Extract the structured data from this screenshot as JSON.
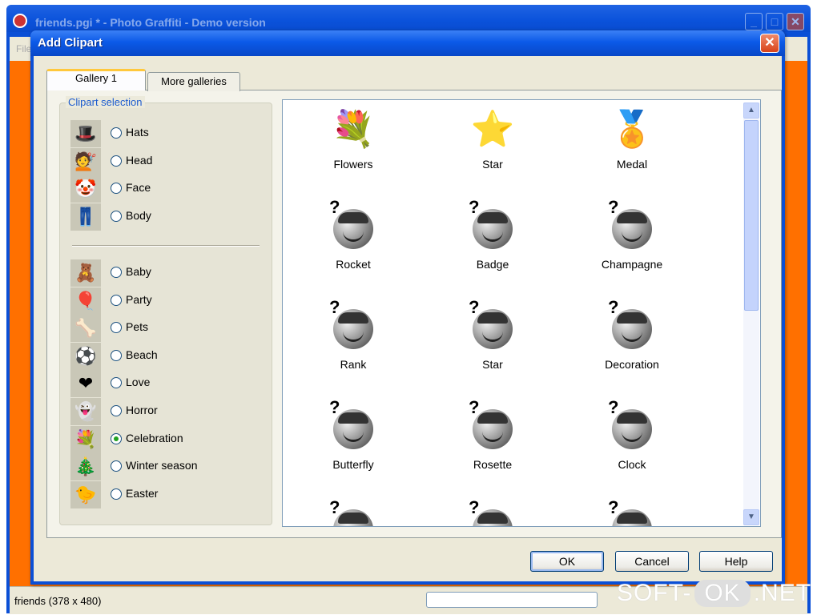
{
  "background_window": {
    "title": "friends.pgi * - Photo Graffiti - Demo version",
    "menu_first": "File",
    "status_text": "friends (378 x 480)",
    "controls": {
      "minimize": "_",
      "maximize": "□",
      "close": "✕"
    }
  },
  "watermark": {
    "prefix": "SOFT-",
    "ok": "OK",
    "suffix": ".NET"
  },
  "dialog": {
    "title": "Add Clipart",
    "close_glyph": "✕",
    "tabs": [
      {
        "label": "Gallery 1",
        "active": true
      },
      {
        "label": "More galleries",
        "active": false
      }
    ],
    "group_label": "Clipart selection",
    "categories_top": [
      {
        "label": "Hats",
        "icon": "hat-icon",
        "glyph": "🎩",
        "checked": false
      },
      {
        "label": "Head",
        "icon": "hair-icon",
        "glyph": "💇",
        "checked": false
      },
      {
        "label": "Face",
        "icon": "clown-nose-icon",
        "glyph": "🤡",
        "checked": false
      },
      {
        "label": "Body",
        "icon": "jeans-icon",
        "glyph": "👖",
        "checked": false
      }
    ],
    "categories_bottom": [
      {
        "label": "Baby",
        "icon": "teddy-bear-icon",
        "glyph": "🧸",
        "checked": false
      },
      {
        "label": "Party",
        "icon": "balloon-icon",
        "glyph": "🎈",
        "checked": false
      },
      {
        "label": "Pets",
        "icon": "bone-icon",
        "glyph": "🦴",
        "checked": false
      },
      {
        "label": "Beach",
        "icon": "beach-ball-icon",
        "glyph": "⚽",
        "checked": false
      },
      {
        "label": "Love",
        "icon": "heart-icon",
        "glyph": "❤",
        "checked": false
      },
      {
        "label": "Horror",
        "icon": "ghost-icon",
        "glyph": "👻",
        "checked": false
      },
      {
        "label": "Celebration",
        "icon": "bouquet-icon",
        "glyph": "💐",
        "checked": true
      },
      {
        "label": "Winter season",
        "icon": "christmas-tree-icon",
        "glyph": "🎄",
        "checked": false
      },
      {
        "label": "Easter",
        "icon": "chick-icon",
        "glyph": "🐤",
        "checked": false
      }
    ],
    "cliparts": [
      {
        "name": "Flowers",
        "art": "flowers-icon",
        "glyph": "💐",
        "placeholder": false
      },
      {
        "name": "Star",
        "art": "star-icon",
        "glyph": "⭐",
        "placeholder": false
      },
      {
        "name": "Medal",
        "art": "medal-icon",
        "glyph": "🏅",
        "placeholder": false
      },
      {
        "name": "Rocket",
        "art": "unknown-clipart-icon",
        "placeholder": true
      },
      {
        "name": "Badge",
        "art": "unknown-clipart-icon",
        "placeholder": true
      },
      {
        "name": "Champagne",
        "art": "unknown-clipart-icon",
        "placeholder": true
      },
      {
        "name": "Rank",
        "art": "unknown-clipart-icon",
        "placeholder": true
      },
      {
        "name": "Star",
        "art": "unknown-clipart-icon",
        "placeholder": true
      },
      {
        "name": "Decoration",
        "art": "unknown-clipart-icon",
        "placeholder": true
      },
      {
        "name": "Butterfly",
        "art": "unknown-clipart-icon",
        "placeholder": true
      },
      {
        "name": "Rosette",
        "art": "unknown-clipart-icon",
        "placeholder": true
      },
      {
        "name": "Clock",
        "art": "unknown-clipart-icon",
        "placeholder": true
      }
    ],
    "buttons": {
      "ok": "OK",
      "cancel": "Cancel",
      "help": "Help"
    },
    "scroll_glyphs": {
      "up": "▲",
      "down": "▼"
    }
  }
}
